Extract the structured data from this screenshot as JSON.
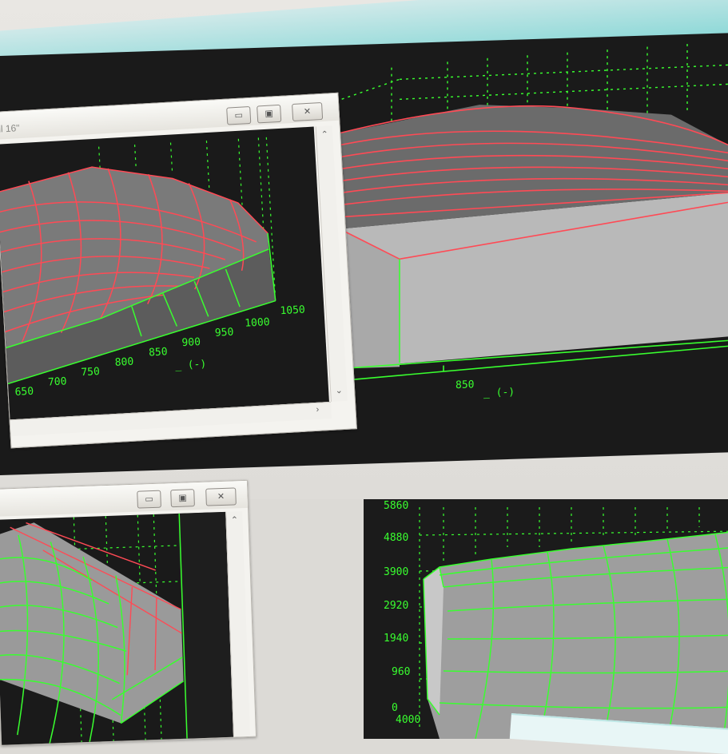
{
  "colors": {
    "grid": "#39ff2f",
    "surface_edges": "#ff4a55",
    "surface_fill": "#b9b9b9",
    "plot_background": "#1a1a1a",
    "window_chrome": "#f4f3ef",
    "accent_band": "#8fd9d8"
  },
  "window_top_left": {
    "title": "ll 16\"",
    "controls": {
      "minimize": "▭",
      "maximize": "▣",
      "close": "✕"
    },
    "x_axis_ticks": [
      "650",
      "700",
      "750",
      "800",
      "850",
      "900",
      "950",
      "1000",
      "1050"
    ],
    "x_axis_unit": "_ (-)",
    "scroll_up": "⌃",
    "scroll_down": "⌄",
    "scroll_right": "›"
  },
  "plot_top_right": {
    "x_axis_tick": "850",
    "x_axis_unit": "_ (-)"
  },
  "window_bottom_left": {
    "controls": {
      "minimize": "▭",
      "maximize": "▣",
      "close": "✕"
    },
    "scroll_up": "⌃"
  },
  "plot_bottom_right": {
    "y_axis_ticks": [
      "5860",
      "4880",
      "3900",
      "2920",
      "1940",
      "960",
      "0"
    ],
    "x_axis_first_tick": "4000"
  }
}
